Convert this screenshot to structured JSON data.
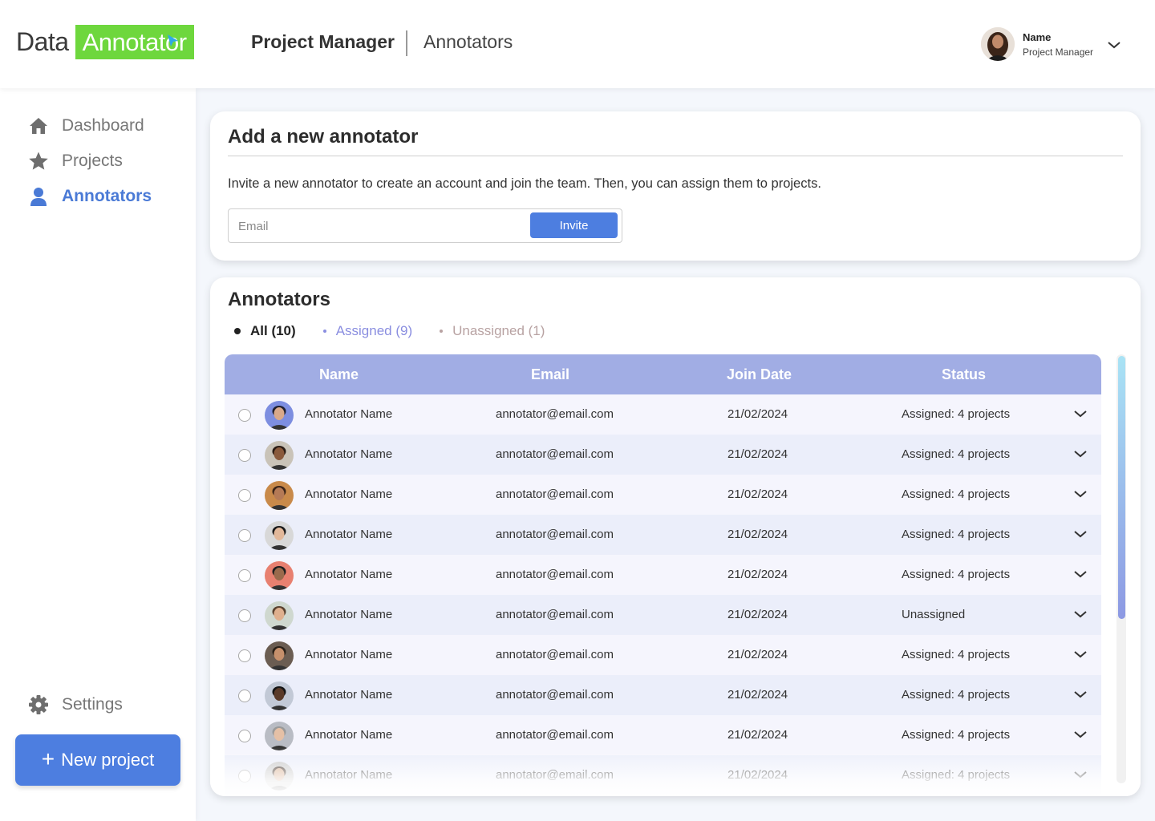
{
  "app": {
    "logo_part1": "Data",
    "logo_part2": "Annotator",
    "header_title": "Project Manager",
    "header_section": "Annotators",
    "accent_color": "#4d7ee0",
    "logo_color": "#6ed73d"
  },
  "user": {
    "name": "Name",
    "role": "Project Manager"
  },
  "sidebar": {
    "items": [
      {
        "label": "Dashboard",
        "icon": "home-icon",
        "active": false
      },
      {
        "label": "Projects",
        "icon": "star-icon",
        "active": false
      },
      {
        "label": "Annotators",
        "icon": "user-icon",
        "active": true
      }
    ],
    "settings_label": "Settings",
    "new_project_label": "New project"
  },
  "add_card": {
    "title": "Add a new annotator",
    "description": "Invite a new annotator to create an account and join the team. Then, you can assign them to projects.",
    "email_placeholder": "Email",
    "email_value": "",
    "invite_label": "Invite"
  },
  "list_card": {
    "title": "Annotators",
    "filters": [
      {
        "label": "All (10)",
        "state": "selected"
      },
      {
        "label": "Assigned (9)",
        "state": "normal"
      },
      {
        "label": "Unassigned (1)",
        "state": "normal"
      }
    ],
    "columns": [
      "Name",
      "Email",
      "Join Date",
      "Status"
    ],
    "rows": [
      {
        "name": "Annotator Name",
        "email": "annotator@email.com",
        "date": "21/02/2024",
        "status": "Assigned: 4 projects"
      },
      {
        "name": "Annotator Name",
        "email": "annotator@email.com",
        "date": "21/02/2024",
        "status": "Assigned: 4 projects"
      },
      {
        "name": "Annotator Name",
        "email": "annotator@email.com",
        "date": "21/02/2024",
        "status": "Assigned: 4 projects"
      },
      {
        "name": "Annotator Name",
        "email": "annotator@email.com",
        "date": "21/02/2024",
        "status": "Assigned: 4 projects"
      },
      {
        "name": "Annotator Name",
        "email": "annotator@email.com",
        "date": "21/02/2024",
        "status": "Assigned: 4 projects"
      },
      {
        "name": "Annotator Name",
        "email": "annotator@email.com",
        "date": "21/02/2024",
        "status": "Unassigned"
      },
      {
        "name": "Annotator Name",
        "email": "annotator@email.com",
        "date": "21/02/2024",
        "status": "Assigned: 4 projects"
      },
      {
        "name": "Annotator Name",
        "email": "annotator@email.com",
        "date": "21/02/2024",
        "status": "Assigned: 4 projects"
      },
      {
        "name": "Annotator Name",
        "email": "annotator@email.com",
        "date": "21/02/2024",
        "status": "Assigned: 4 projects"
      },
      {
        "name": "Annotator Name",
        "email": "annotator@email.com",
        "date": "21/02/2024",
        "status": "Assigned: 4 projects"
      }
    ]
  }
}
